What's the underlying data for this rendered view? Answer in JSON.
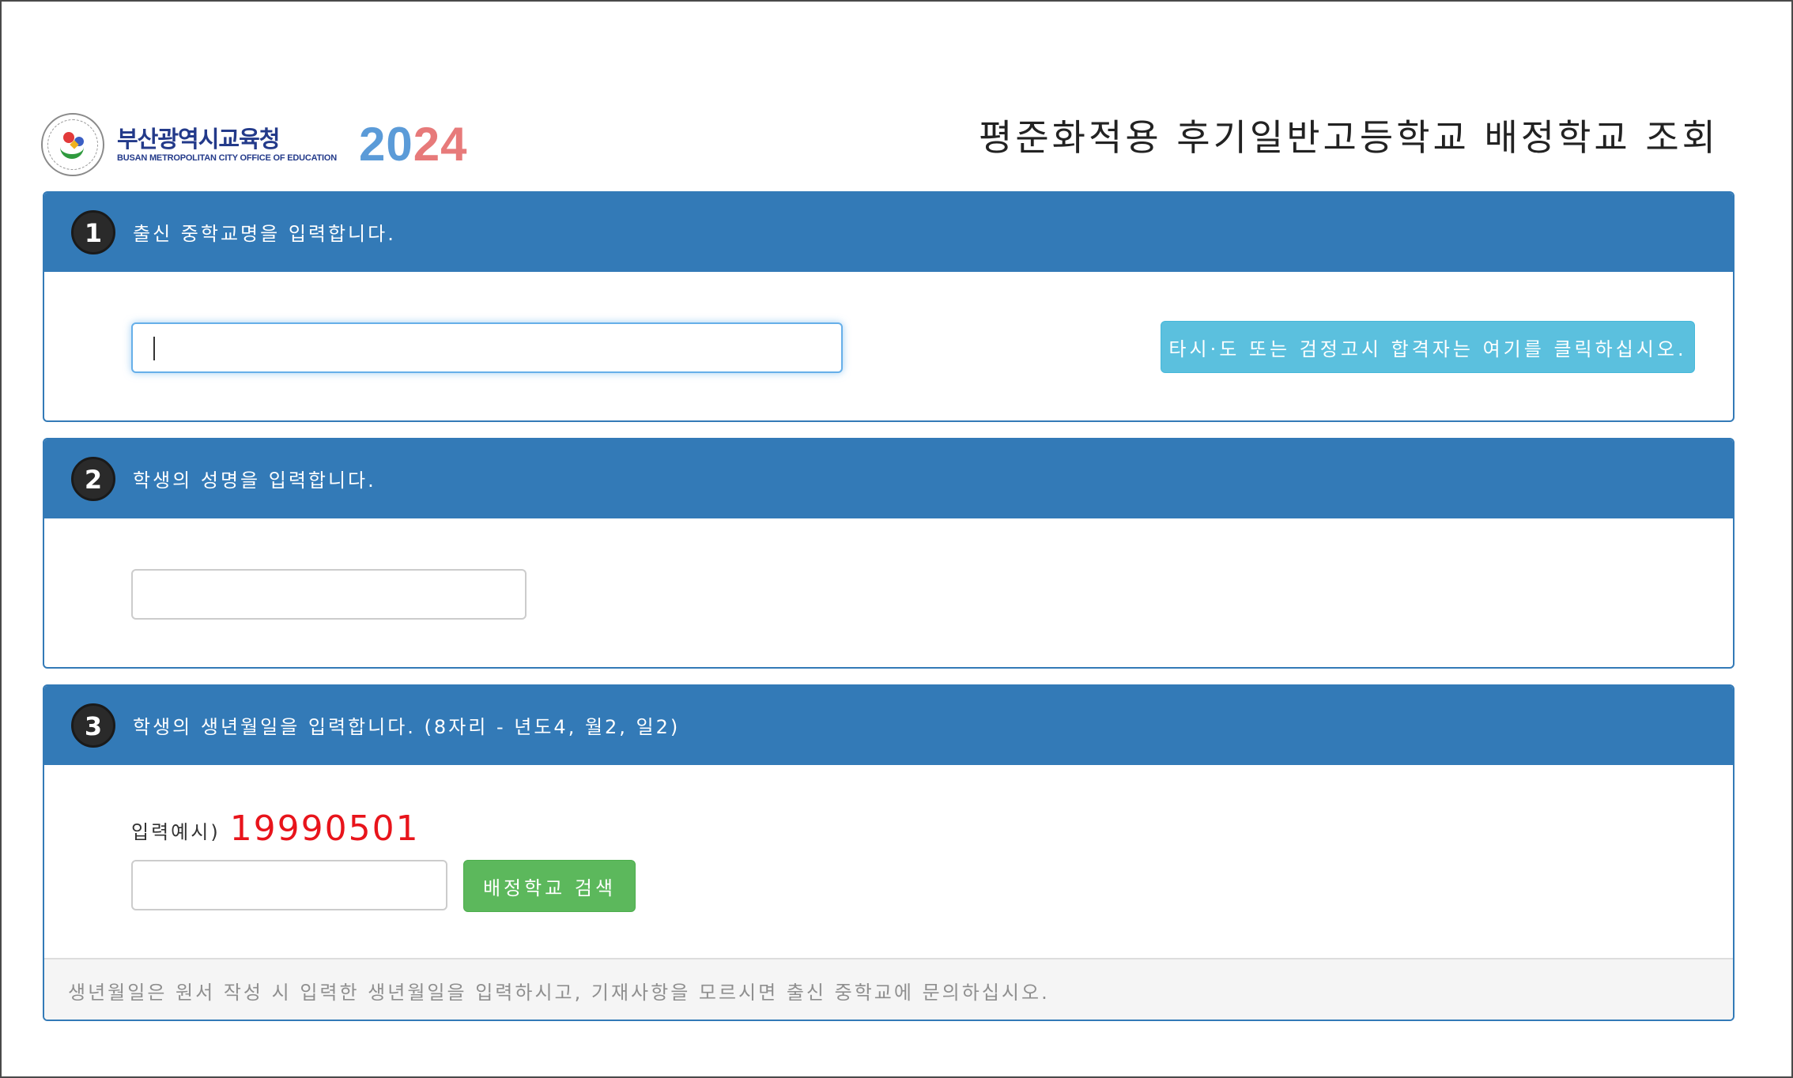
{
  "header": {
    "org_name_ko": "부산광역시교육청",
    "org_name_en": "BUSAN METROPOLITAN CITY OFFICE OF EDUCATION",
    "year_part1": "20",
    "year_part2": "24",
    "page_title": "평준화적용 후기일반고등학교 배정학교 조회"
  },
  "steps": [
    {
      "number": "1",
      "instruction": "출신 중학교명을 입력합니다.",
      "input_value": "",
      "other_region_button": "타시·도 또는 검정고시 합격자는 여기를 클릭하십시오."
    },
    {
      "number": "2",
      "instruction": "학생의 성명을 입력합니다.",
      "input_value": ""
    },
    {
      "number": "3",
      "instruction": "학생의 생년월일을 입력합니다. (8자리 - 년도4, 월2, 일2)",
      "example_label": "입력예시)",
      "example_value": "19990501",
      "input_value": "",
      "search_button": "배정학교 검색",
      "footer_note": "생년월일은 원서 작성 시 입력한 생년월일을 입력하시고, 기재사항을 모르시면 출신 중학교에 문의하십시오."
    }
  ],
  "colors": {
    "panel_header": "#337ab7",
    "info_button": "#5bc0de",
    "success_button": "#5cb85c",
    "example_value": "#e8141b"
  }
}
